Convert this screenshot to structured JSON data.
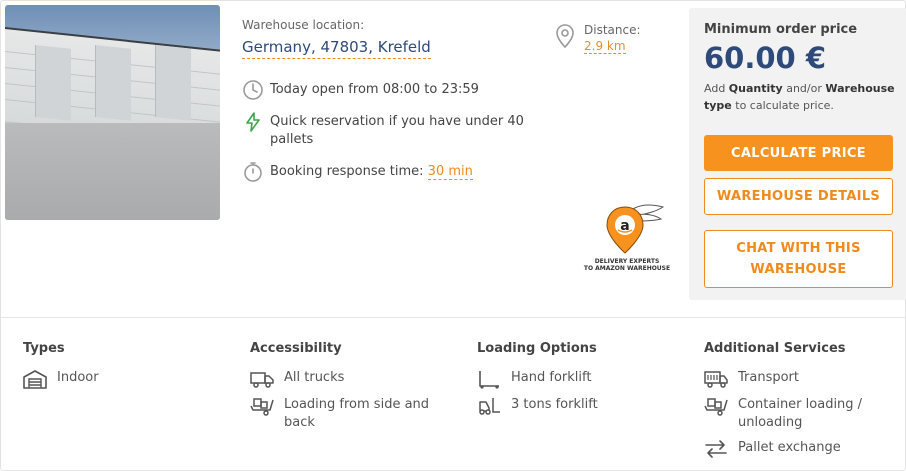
{
  "location": {
    "label": "Warehouse location:",
    "value": "Germany, 47803, Krefeld"
  },
  "distance": {
    "label": "Distance:",
    "value": "2.9 km"
  },
  "info": {
    "hours": "Today open from 08:00 to 23:59",
    "quick_reservation": "Quick reservation if you have under 40 pallets",
    "response_label": "Booking response time:",
    "response_value": "30 min"
  },
  "badge": {
    "line1": "DELIVERY EXPERTS",
    "line2": "TO AMAZON WAREHOUSE"
  },
  "pricing": {
    "label": "Minimum order price",
    "price": "60.00 €",
    "hint_prefix": "Add ",
    "hint_quantity": "Quantity",
    "hint_mid": " and/or ",
    "hint_type": "Warehouse type",
    "hint_suffix": " to calculate price.",
    "calculate_button": "CALCULATE PRICE",
    "details_button": "WAREHOUSE DETAILS",
    "chat_button": "CHAT WITH THIS WAREHOUSE"
  },
  "features": {
    "types": {
      "title": "Types",
      "items": [
        "Indoor"
      ]
    },
    "accessibility": {
      "title": "Accessibility",
      "items": [
        "All trucks",
        "Loading from side and back"
      ]
    },
    "loading": {
      "title": "Loading Options",
      "items": [
        "Hand forklift",
        "3 tons forklift"
      ]
    },
    "services": {
      "title": "Additional Services",
      "items": [
        "Transport",
        "Container loading / unloading",
        "Pallet exchange"
      ]
    }
  },
  "colors": {
    "accent": "#f7921e",
    "link_blue": "#2d4a7a",
    "panel_bg": "#f2f2f2",
    "icon_gray": "#9a9a9a",
    "lightning_green": "#3fa34d"
  },
  "icons": {
    "clock": "clock-icon",
    "lightning": "lightning-icon",
    "timer": "stopwatch-icon",
    "pin": "location-pin-icon",
    "warehouse": "warehouse-icon",
    "truck": "truck-icon",
    "dolly": "dolly-icon",
    "hand_forklift": "hand-forklift-icon",
    "forklift": "forklift-icon",
    "transport": "transport-truck-icon",
    "container": "container-loading-icon",
    "exchange": "exchange-arrows-icon"
  }
}
